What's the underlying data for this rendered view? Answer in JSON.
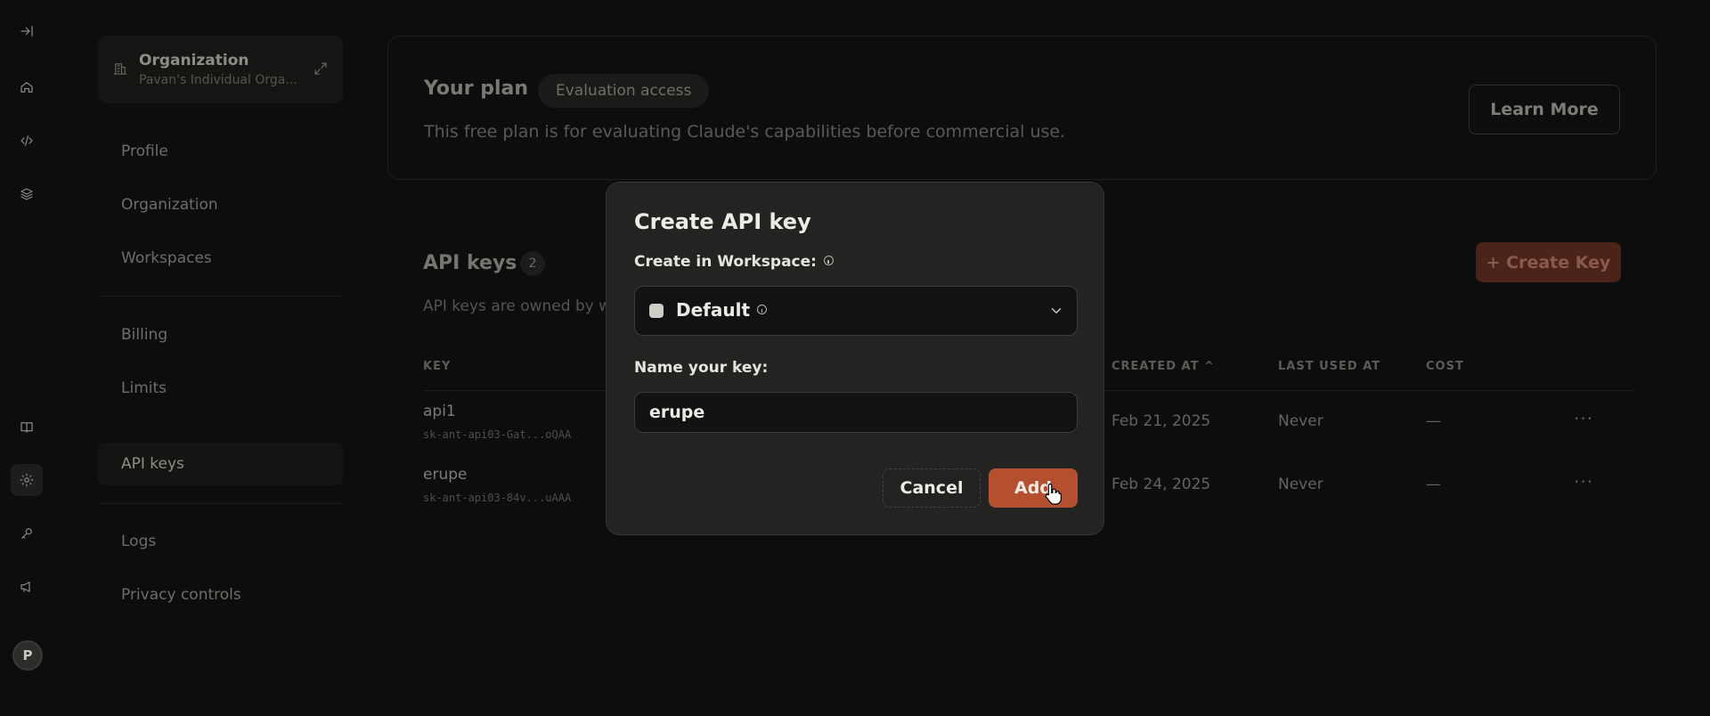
{
  "settings_nav": {
    "org_title": "Organization",
    "org_subtitle": "Pavan's Individual Orga...",
    "items": [
      {
        "label": "Profile"
      },
      {
        "label": "Organization"
      },
      {
        "label": "Workspaces"
      },
      {
        "label": "Billing"
      },
      {
        "label": "Limits"
      },
      {
        "label": "API keys"
      },
      {
        "label": "Logs"
      },
      {
        "label": "Privacy controls"
      }
    ]
  },
  "rail": {
    "icons": [
      "collapse-icon",
      "home-icon",
      "code-icon",
      "layers-icon",
      "book-icon",
      "gear-icon",
      "key-icon",
      "megaphone-icon"
    ],
    "avatar_initial": "P"
  },
  "plan": {
    "title": "Your plan",
    "badge": "Evaluation access",
    "description": "This free plan is for evaluating Claude's capabilities before commercial use.",
    "learn_more": "Learn More"
  },
  "api_keys": {
    "title": "API keys",
    "count": "2",
    "description": "API keys are owned by w",
    "create_label": "+ Create Key",
    "columns": {
      "key": "KEY",
      "created_at": "CREATED AT ^",
      "last_used_at": "LAST USED AT",
      "cost": "COST"
    },
    "rows": [
      {
        "name": "api1",
        "key": "sk-ant-api03-Gat...oQAA",
        "created": "Feb 21, 2025",
        "last_used": "Never",
        "cost": "—",
        "more": "···"
      },
      {
        "name": "erupe",
        "key": "sk-ant-api03-84v...uAAA",
        "created": "Feb 24, 2025",
        "last_used": "Never",
        "cost": "—",
        "more": "···"
      }
    ]
  },
  "modal": {
    "title": "Create API key",
    "workspace_label": "Create in Workspace:",
    "workspace_value": "Default",
    "name_label": "Name your key:",
    "name_value": "erupe",
    "cancel": "Cancel",
    "add": "Add"
  },
  "colors": {
    "accent": "#b4502f",
    "background": "#0d0d0d",
    "modal_bg": "#232322"
  }
}
